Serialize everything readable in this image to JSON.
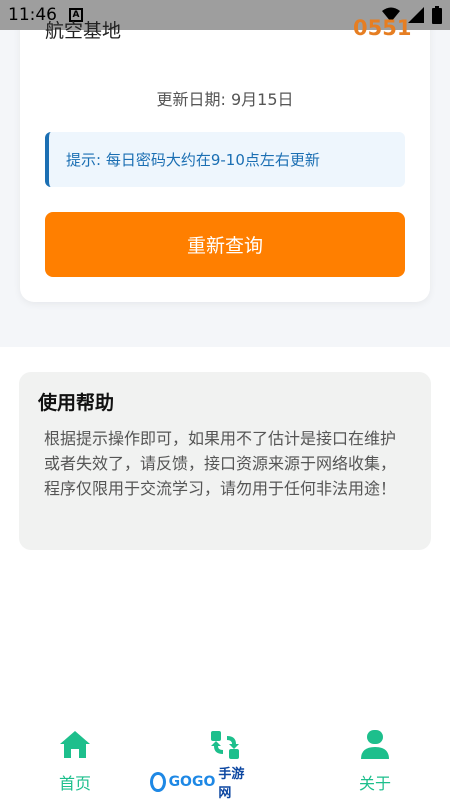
{
  "status_bar": {
    "time": "11:46",
    "notification_letter": "A"
  },
  "result_card": {
    "place_name": "航空基地",
    "code": "0551",
    "update_date": "更新日期: 9月15日",
    "tip": "提示: 每日密码大约在9-10点左右更新",
    "requery_label": "重新查询"
  },
  "help": {
    "title": "使用帮助",
    "body": "根据提示操作即可，如果用不了估计是接口在维护或者失效了，请反馈，接口资源来源于网络收集，程序仅限用于交流学习，请勿用于任何非法用途！"
  },
  "bottom_nav": {
    "home_label": "首页",
    "about_label": "关于"
  },
  "watermark": {
    "brand": "GOGO",
    "suffix": "手游网"
  },
  "colors": {
    "accent_orange": "#ff7f00",
    "code_orange": "#e67e22",
    "nav_green": "#1dbf8c",
    "tip_blue": "#1b6fb3"
  }
}
